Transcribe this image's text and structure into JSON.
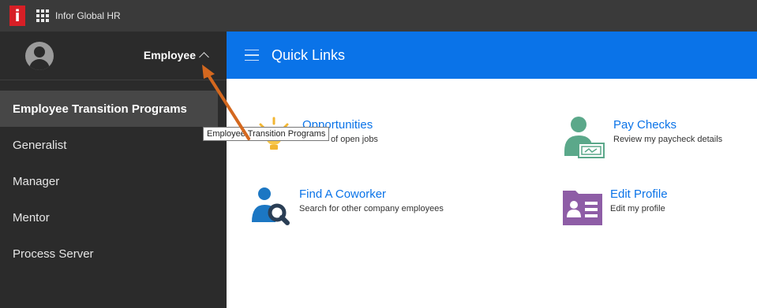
{
  "topbar": {
    "app_title": "Infor Global HR",
    "logo_letter": "i"
  },
  "sidebar": {
    "role_label": "Employee",
    "items": [
      {
        "label": "Employee Transition Programs"
      },
      {
        "label": "Generalist"
      },
      {
        "label": "Manager"
      },
      {
        "label": "Mentor"
      },
      {
        "label": "Process Server"
      }
    ]
  },
  "header": {
    "title": "Quick Links"
  },
  "tiles": [
    {
      "title": "Opportunities",
      "subtitle": "of open jobs"
    },
    {
      "title": "Pay Checks",
      "subtitle": "Review my paycheck details"
    },
    {
      "title": "Find A Coworker",
      "subtitle": "Search for other company employees"
    },
    {
      "title": "Edit Profile",
      "subtitle": "Edit my profile"
    }
  ],
  "tooltip": {
    "text": "Employee Transition Programs"
  },
  "colors": {
    "brand_blue": "#0a73e8",
    "sidebar_bg": "#2b2b2b",
    "topbar_bg": "#3a3a3a",
    "logo_red": "#d71f26",
    "annotation_arrow": "#d4681f"
  },
  "icons": [
    "grid-icon",
    "avatar-icon",
    "chevron-up-icon",
    "hamburger-icon",
    "lightbulb-icon",
    "paycheck-icon",
    "coworker-search-icon",
    "profile-card-icon"
  ]
}
